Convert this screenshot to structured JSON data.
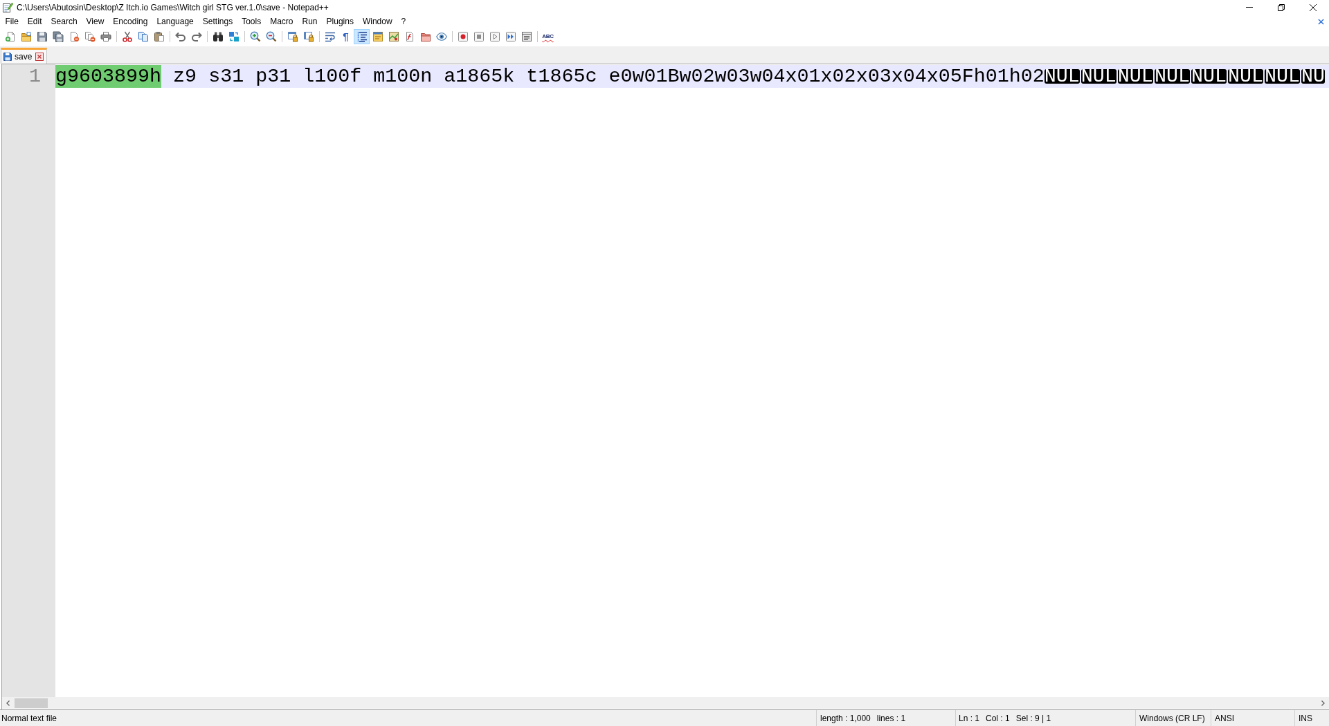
{
  "window": {
    "title": "C:\\Users\\Abutosin\\Desktop\\Z Itch.io Games\\Witch girl STG ver.1.0\\save - Notepad++"
  },
  "menu": [
    {
      "label": "File"
    },
    {
      "label": "Edit"
    },
    {
      "label": "Search"
    },
    {
      "label": "View"
    },
    {
      "label": "Encoding"
    },
    {
      "label": "Language"
    },
    {
      "label": "Settings"
    },
    {
      "label": "Tools"
    },
    {
      "label": "Macro"
    },
    {
      "label": "Run"
    },
    {
      "label": "Plugins"
    },
    {
      "label": "Window"
    },
    {
      "label": "?"
    }
  ],
  "toolbar": {
    "groups": [
      [
        {
          "kind": "icon",
          "pressed": false
        },
        {
          "kind": "icon",
          "pressed": false
        },
        {
          "kind": "icon",
          "pressed": false
        },
        {
          "kind": "icon",
          "pressed": false
        },
        {
          "kind": "icon",
          "pressed": false
        },
        {
          "kind": "icon",
          "pressed": false
        },
        {
          "kind": "icon",
          "pressed": false
        }
      ],
      [
        {
          "kind": "icon",
          "pressed": false
        },
        {
          "kind": "icon",
          "pressed": false
        },
        {
          "kind": "icon",
          "pressed": false
        }
      ],
      [
        {
          "kind": "icon",
          "pressed": false
        },
        {
          "kind": "icon",
          "pressed": false
        }
      ],
      [
        {
          "kind": "icon",
          "pressed": false
        },
        {
          "kind": "icon",
          "pressed": false
        }
      ],
      [
        {
          "kind": "icon",
          "pressed": false
        },
        {
          "kind": "icon",
          "pressed": false
        }
      ],
      [
        {
          "kind": "icon",
          "pressed": false
        },
        {
          "kind": "icon",
          "pressed": false
        }
      ],
      [
        {
          "kind": "icon",
          "pressed": false
        },
        {
          "kind": "symbol",
          "label": "¶",
          "pressed": false
        },
        {
          "kind": "icon",
          "pressed": true
        },
        {
          "kind": "icon",
          "pressed": false
        },
        {
          "kind": "icon",
          "pressed": false
        },
        {
          "kind": "icon",
          "pressed": false
        },
        {
          "kind": "icon",
          "pressed": false
        },
        {
          "kind": "icon",
          "pressed": false
        }
      ],
      [
        {
          "kind": "icon",
          "pressed": false
        },
        {
          "kind": "icon",
          "pressed": false
        },
        {
          "kind": "icon",
          "pressed": false
        },
        {
          "kind": "icon",
          "pressed": false
        },
        {
          "kind": "icon",
          "pressed": false
        }
      ],
      [
        {
          "kind": "spelling",
          "label": "ABC",
          "pressed": false
        }
      ]
    ]
  },
  "tabs": [
    {
      "label": "save",
      "selected": true
    }
  ],
  "editor": {
    "lines": [
      {
        "number": "1",
        "current": true,
        "segments": [
          {
            "text": "g9603899h",
            "selected": true
          },
          {
            "text": " z9 s31 p31 l100f m100n a1865k t1865c e0w01Bw02w03w04x01x02x03x04x05Fh01h02",
            "selected": false
          }
        ],
        "control_chars": [
          "NUL",
          "NUL",
          "NUL",
          "NUL",
          "NUL",
          "NUL",
          "NUL",
          "NU"
        ]
      }
    ]
  },
  "status_bar": {
    "file_type": "Normal text file",
    "document": [
      "length : 1,000",
      "lines : 1"
    ],
    "position": [
      "Ln : 1",
      "Col : 1",
      "Sel : 9 | 1"
    ],
    "line_ending": "Windows (CR LF)",
    "encoding": "ANSI",
    "mode": "INS"
  }
}
